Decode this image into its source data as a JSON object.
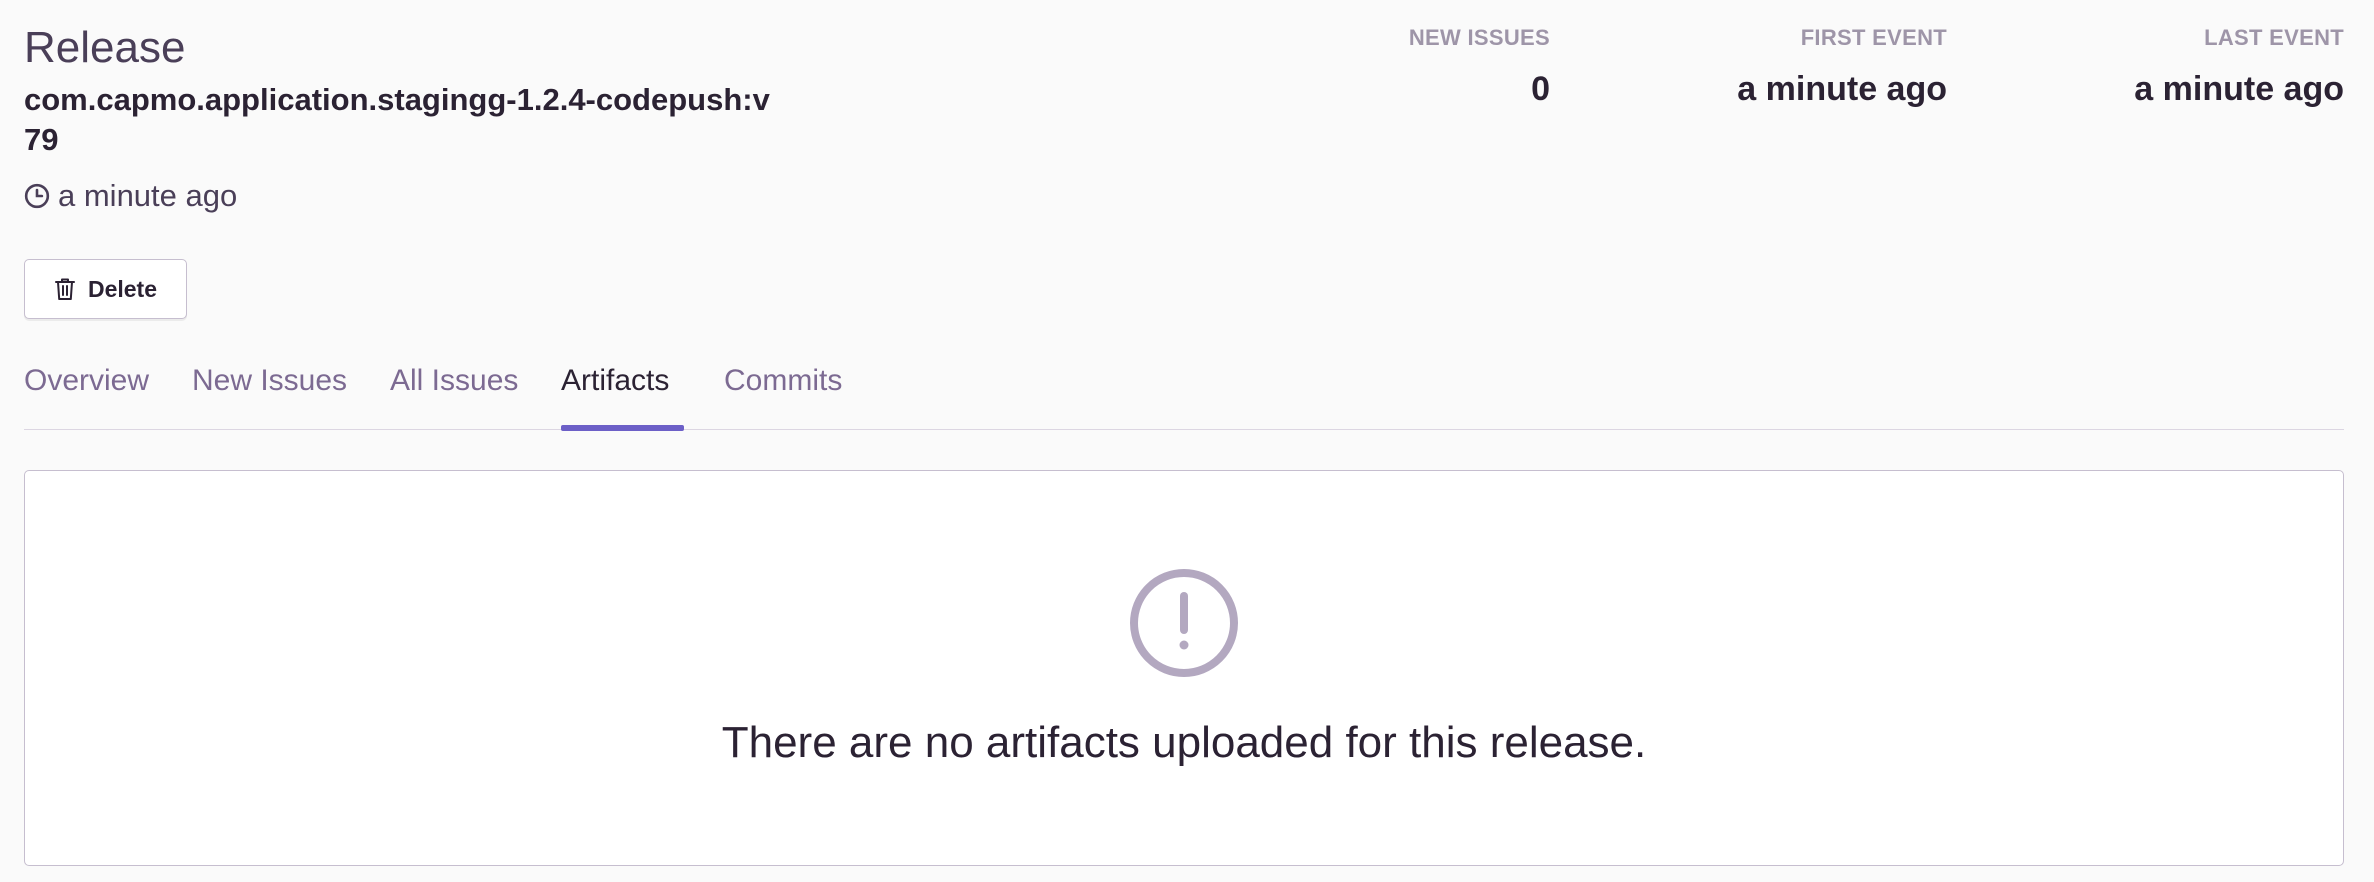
{
  "release": {
    "heading": "Release",
    "version": "com.capmo.application.stagingg-1.2.4-codepush:v79",
    "time": "a minute ago",
    "clock_icon": "clock-icon"
  },
  "actions": {
    "delete_label": "Delete",
    "delete_icon": "trash-icon"
  },
  "stats": {
    "new_issues_label": "NEW ISSUES",
    "new_issues_value": "0",
    "first_event_label": "FIRST EVENT",
    "first_event_value": "a minute ago",
    "last_event_label": "LAST EVENT",
    "last_event_value": "a minute ago"
  },
  "tabs": [
    {
      "label": "Overview"
    },
    {
      "label": "New Issues"
    },
    {
      "label": "All Issues"
    },
    {
      "label": "Artifacts",
      "active": true
    },
    {
      "label": "Commits"
    }
  ],
  "empty_state": {
    "icon": "exclamation-circle-icon",
    "message": "There are no artifacts uploaded for this release."
  },
  "colors": {
    "accent": "#6c5fc7",
    "text_primary": "#2b2233",
    "text_muted": "#7c6a92",
    "icon_muted": "#b3a8c0"
  }
}
